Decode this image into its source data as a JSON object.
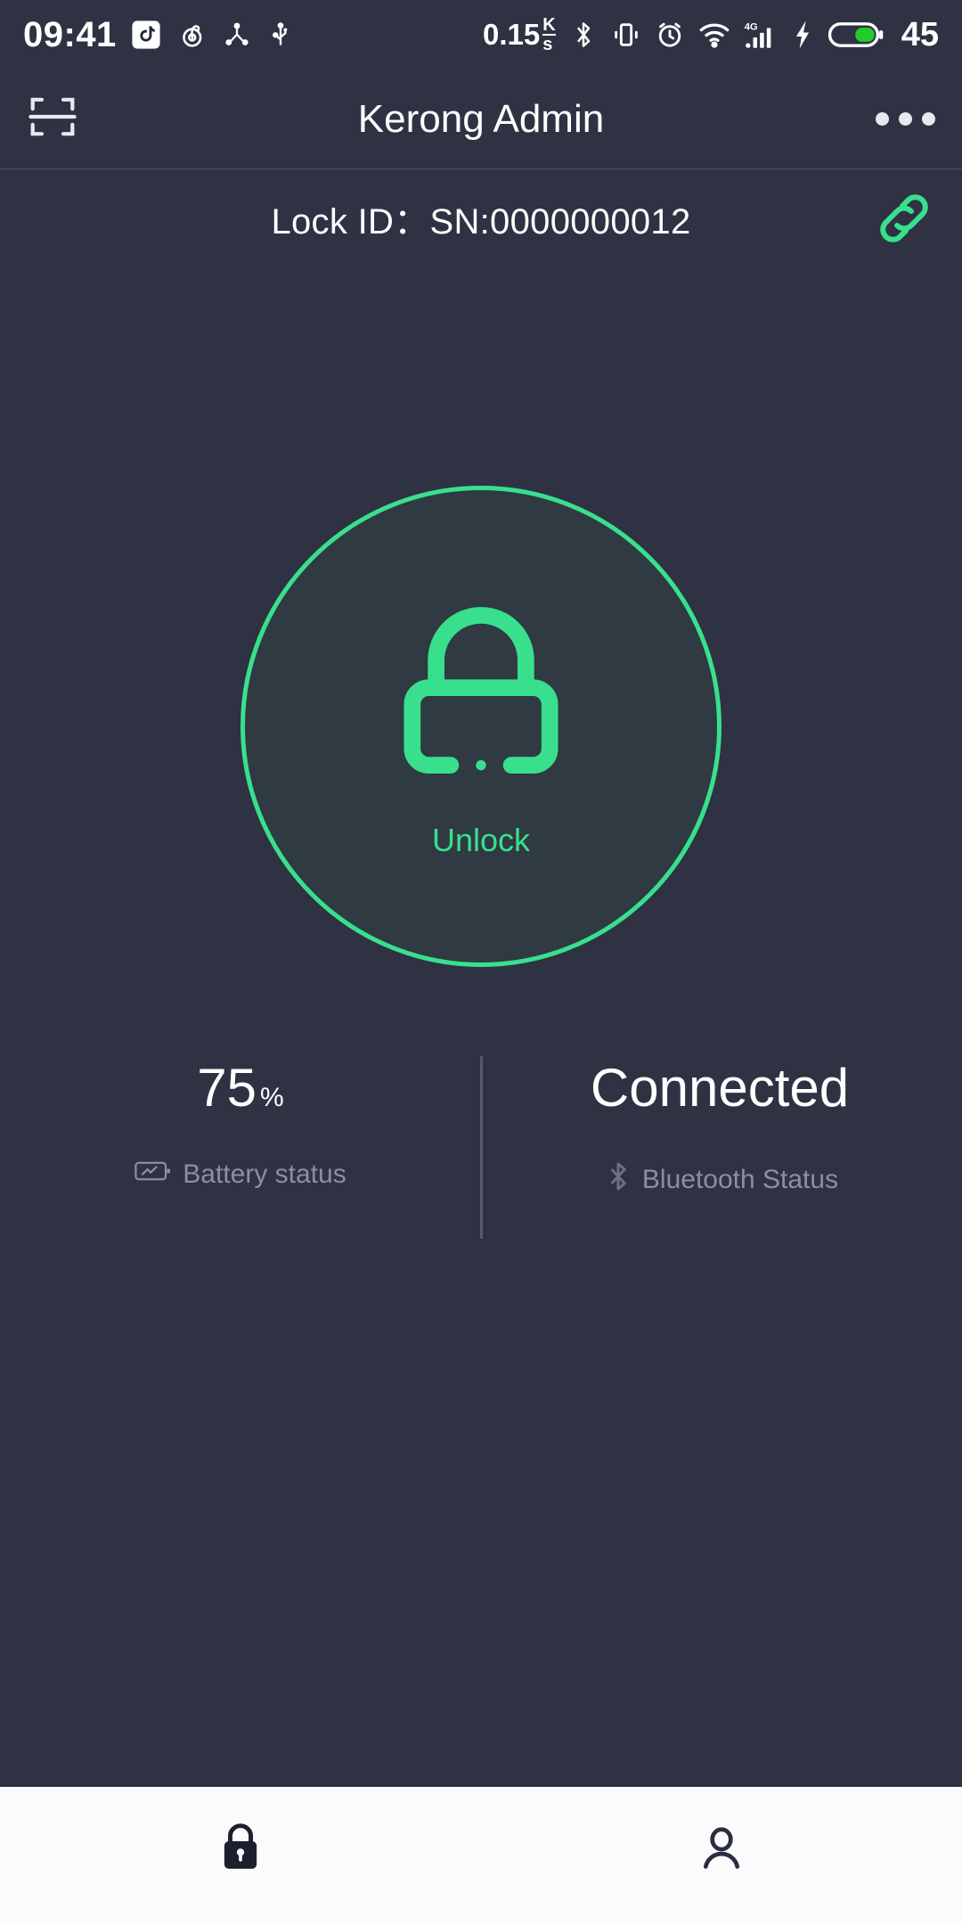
{
  "status_bar": {
    "time": "09:41",
    "left_icons": [
      "tiktok-icon",
      "netease-music-icon",
      "share-icon",
      "usb-icon"
    ],
    "network_speed": "0.15",
    "speed_unit_top": "K",
    "speed_unit_bottom": "s",
    "right_icons": [
      "bluetooth-icon",
      "vibrate-icon",
      "alarm-icon",
      "wifi-icon",
      "signal-4g-icon",
      "charging-bolt-icon"
    ],
    "signal_label": "4G",
    "battery_level": "45",
    "battery_color": "#22cc2a"
  },
  "app_bar": {
    "title": "Kerong Admin",
    "scan_icon": "qr-scan-icon",
    "overflow_icon": "more-options-icon"
  },
  "lock_info": {
    "label": "Lock ID：SN:0000000012",
    "link_icon": "chain-link-icon"
  },
  "unlock": {
    "label": "Unlock",
    "icon": "padlock-outline-icon"
  },
  "stats": [
    {
      "value": "75",
      "suffix": "%",
      "sub_label": "Battery status",
      "icon": "battery-charge-icon"
    },
    {
      "value": "Connected",
      "suffix": "",
      "sub_label": "Bluetooth Status",
      "icon": "bluetooth-icon"
    }
  ],
  "bottom_nav": [
    {
      "icon": "lock-filled-icon",
      "active": true
    },
    {
      "icon": "person-outline-icon",
      "active": false
    }
  ],
  "colors": {
    "background": "#2e3242",
    "accent_green": "#38e08d",
    "circle_fill": "#2f3a42",
    "muted_text": "#8b8fa0",
    "nav_background": "#fbfbfd"
  }
}
